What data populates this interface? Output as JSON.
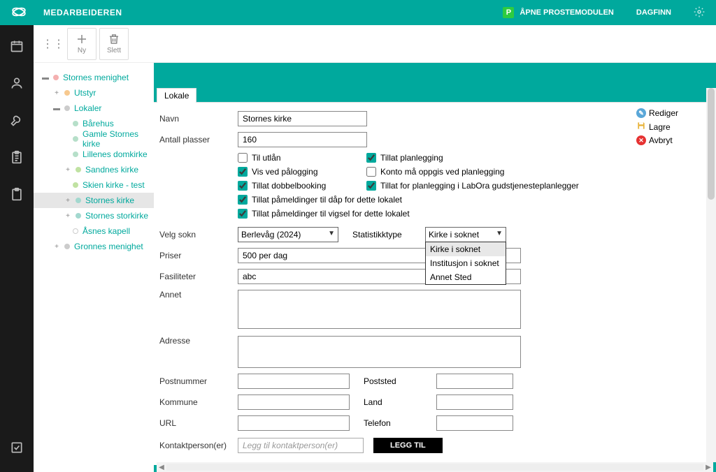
{
  "topbar": {
    "product": "MEDARBEIDEREN",
    "proste_label": "ÅPNE PROSTEMODULEN",
    "proste_badge": "P",
    "user": "DAGFINN"
  },
  "toolbar": {
    "ny": "Ny",
    "slett": "Slett"
  },
  "tree": {
    "l0": "Stornes menighet",
    "l1": "Utstyr",
    "l2": "Lokaler",
    "barehus": "Bårehus",
    "gamle": "Gamle Stornes kirke",
    "lillenes": "Lillenes domkirke",
    "sandnes": "Sandnes kirke",
    "skien": "Skien kirke - test",
    "stornes": "Stornes kirke",
    "stork": "Stornes storkirke",
    "asnes": "Åsnes kapell",
    "gronnes": "Gronnes menighet"
  },
  "tab": {
    "title": "Lokale"
  },
  "labels": {
    "navn": "Navn",
    "antall": "Antall plasser",
    "velgsokn": "Velg sokn",
    "stattype": "Statistikktype",
    "priser": "Priser",
    "fasiliteter": "Fasiliteter",
    "annet": "Annet",
    "adresse": "Adresse",
    "postnr": "Postnummer",
    "poststed": "Poststed",
    "kommune": "Kommune",
    "land": "Land",
    "url": "URL",
    "telefon": "Telefon",
    "kontakt": "Kontaktperson(er)"
  },
  "values": {
    "navn": "Stornes kirke",
    "antall": "160",
    "sokn_sel": "Berlevåg (2024)",
    "stattype_sel": "Kirke i soknet",
    "priser": "500 per dag",
    "fasiliteter": "abc",
    "kontakt_placeholder": "Legg til kontaktperson(er)",
    "legg_btn": "LEGG TIL"
  },
  "checks": {
    "tilutlan": "Til utlån",
    "tillat_plan": "Tillat planlegging",
    "vis_ved": "Vis ved pålogging",
    "konto_ma": "Konto må oppgis ved planlegging",
    "tillat_db": "Tillat dobbelbooking",
    "tillat_labora": "Tillat for planlegging i LabOra gudstjenesteplanlegger",
    "pam_dap": "Tillat påmeldinger til dåp for dette lokalet",
    "pam_vigsel": "Tillat påmeldinger til vigsel for dette lokalet"
  },
  "stattype_options": {
    "o1": "Kirke i soknet",
    "o2": "Institusjon i soknet",
    "o3": "Annet Sted"
  },
  "actions": {
    "rediger": "Rediger",
    "lagre": "Lagre",
    "avbryt": "Avbryt"
  }
}
